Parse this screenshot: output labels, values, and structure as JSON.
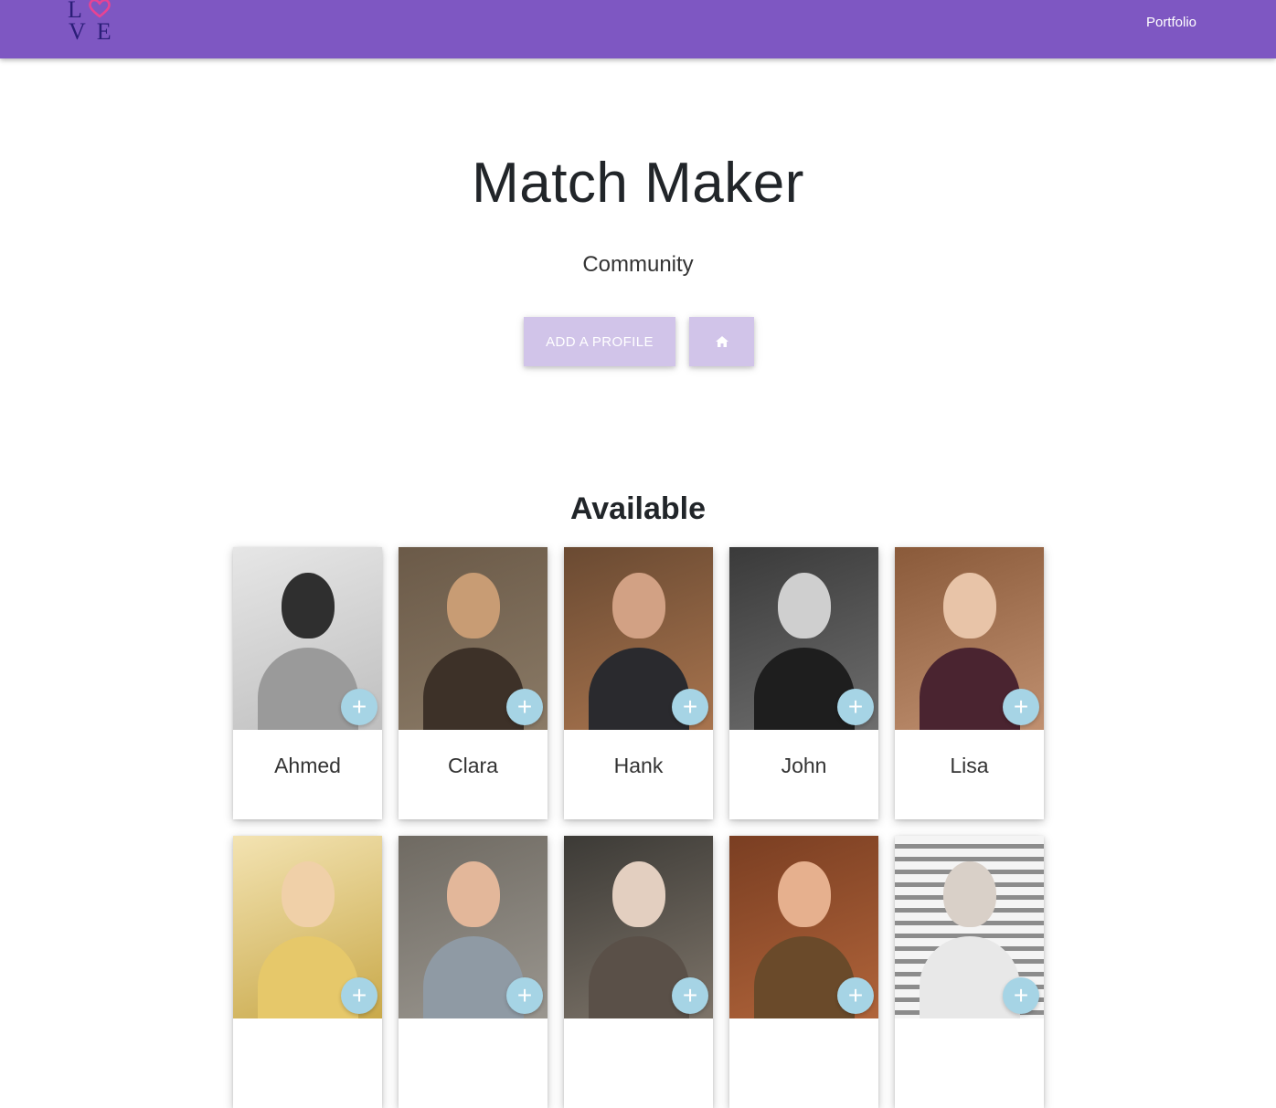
{
  "navbar": {
    "logo_letters_top": "L",
    "logo_letters_bottom": "V E",
    "link": "Portfolio",
    "color": "#7e57c2"
  },
  "hero": {
    "title": "Match Maker",
    "subtitle": "Community",
    "add_button": "ADD A PROFILE",
    "home_icon": "home-icon",
    "button_color": "#d1c4e9"
  },
  "section": {
    "title": "Available"
  },
  "profiles": [
    {
      "name": "Ahmed"
    },
    {
      "name": "Clara"
    },
    {
      "name": "Hank"
    },
    {
      "name": "John"
    },
    {
      "name": "Lisa"
    },
    {
      "name": ""
    },
    {
      "name": ""
    },
    {
      "name": ""
    },
    {
      "name": ""
    },
    {
      "name": ""
    }
  ],
  "add_icon": "plus-icon",
  "fab_color": "#a6d4e5"
}
